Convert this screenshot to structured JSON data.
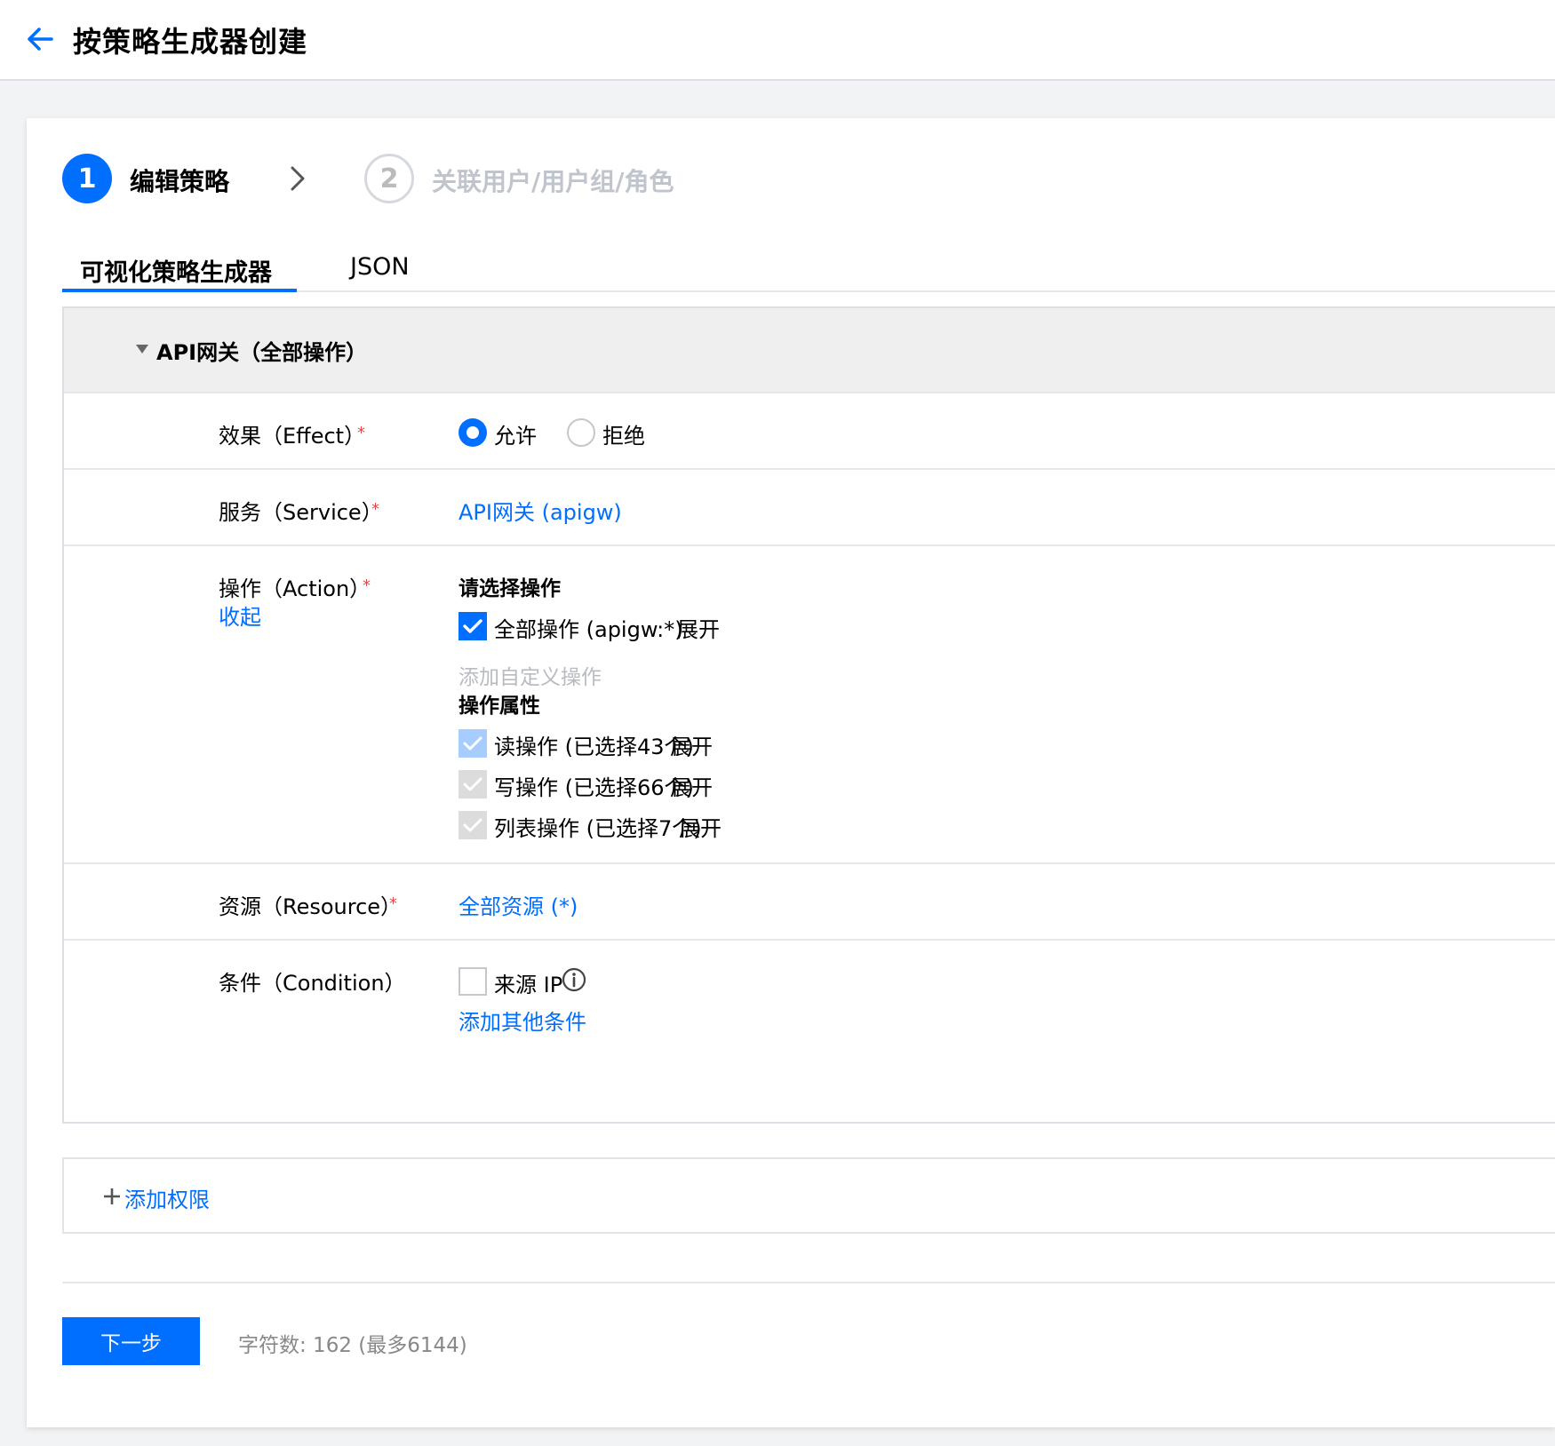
{
  "header": {
    "title": "按策略生成器创建",
    "back_icon": "arrow-left-icon"
  },
  "steps": [
    {
      "number": "1",
      "label": "编辑策略",
      "active": true
    },
    {
      "number": "2",
      "label": "关联用户/用户组/角色",
      "active": false
    }
  ],
  "tabs": [
    {
      "label": "可视化策略生成器",
      "active": true
    },
    {
      "label": "JSON",
      "active": false
    }
  ],
  "policy": {
    "title": "API网关（全部操作）",
    "effect": {
      "label": "效果（Effect）",
      "required_mark": "*",
      "options": [
        {
          "label": "允许",
          "selected": true
        },
        {
          "label": "拒绝",
          "selected": false
        }
      ]
    },
    "service": {
      "label": "服务（Service）",
      "required_mark": "*",
      "value": "API网关 (apigw)"
    },
    "action": {
      "label": "操作（Action）",
      "required_mark": "*",
      "collapse_link": "收起",
      "select_title": "请选择操作",
      "all_actions": {
        "label": "全部操作 (apigw:*)",
        "checked": true,
        "expand": "展开"
      },
      "add_custom": "添加自定义操作",
      "attributes_title": "操作属性",
      "attributes": [
        {
          "label": "读操作 (已选择43个)",
          "expand": "展开",
          "state": "checked-light"
        },
        {
          "label": "写操作 (已选择66个)",
          "expand": "展开",
          "state": "checked-gray"
        },
        {
          "label": "列表操作 (已选择7个)",
          "expand": "展开",
          "state": "checked-gray"
        }
      ]
    },
    "resource": {
      "label": "资源（Resource）",
      "required_mark": "*",
      "value": "全部资源 (*)"
    },
    "condition": {
      "label": "条件（Condition）",
      "source_ip": {
        "label": "来源 IP",
        "checked": false,
        "icon": "info-icon"
      },
      "add_other": "添加其他条件"
    }
  },
  "add_permission": {
    "label": "添加权限",
    "icon": "plus-icon"
  },
  "footer": {
    "next_button": "下一步",
    "char_count": "字符数: 162 (最多6144)"
  },
  "colors": {
    "primary": "#006eff",
    "required": "#e54545",
    "muted": "#b8bcc2"
  }
}
